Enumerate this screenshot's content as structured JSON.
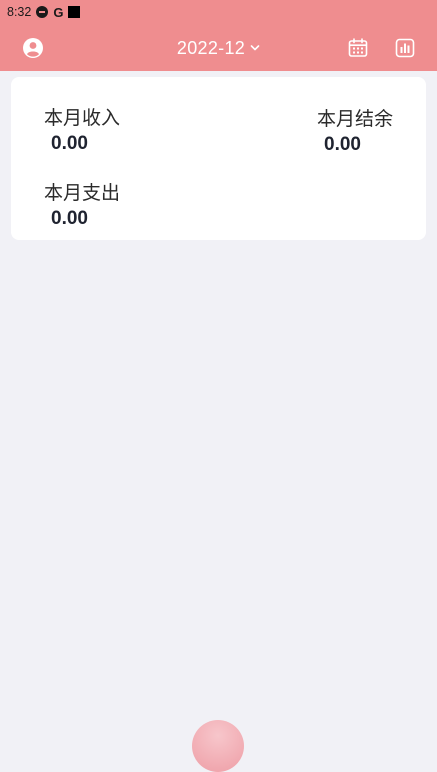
{
  "status_bar": {
    "time": "8:32",
    "icons": [
      "circle-badge-icon",
      "google-g-icon",
      "square-icon"
    ],
    "g_glyph": "G"
  },
  "header": {
    "month": "2022-12",
    "icons": [
      "account-circle-icon",
      "chevron-down-icon",
      "calendar-icon",
      "bar-chart-icon"
    ]
  },
  "summary": {
    "income_label": "本月收入",
    "income_value": "0.00",
    "balance_label": "本月结余",
    "balance_value": "0.00",
    "expense_label": "本月支出",
    "expense_value": "0.00"
  },
  "fab": {
    "icon": "add-record-button-icon"
  },
  "colors": {
    "primary": "#ef8d8f",
    "background": "#f1f1f6",
    "card": "#ffffff",
    "fab": "#f3b2b8"
  }
}
